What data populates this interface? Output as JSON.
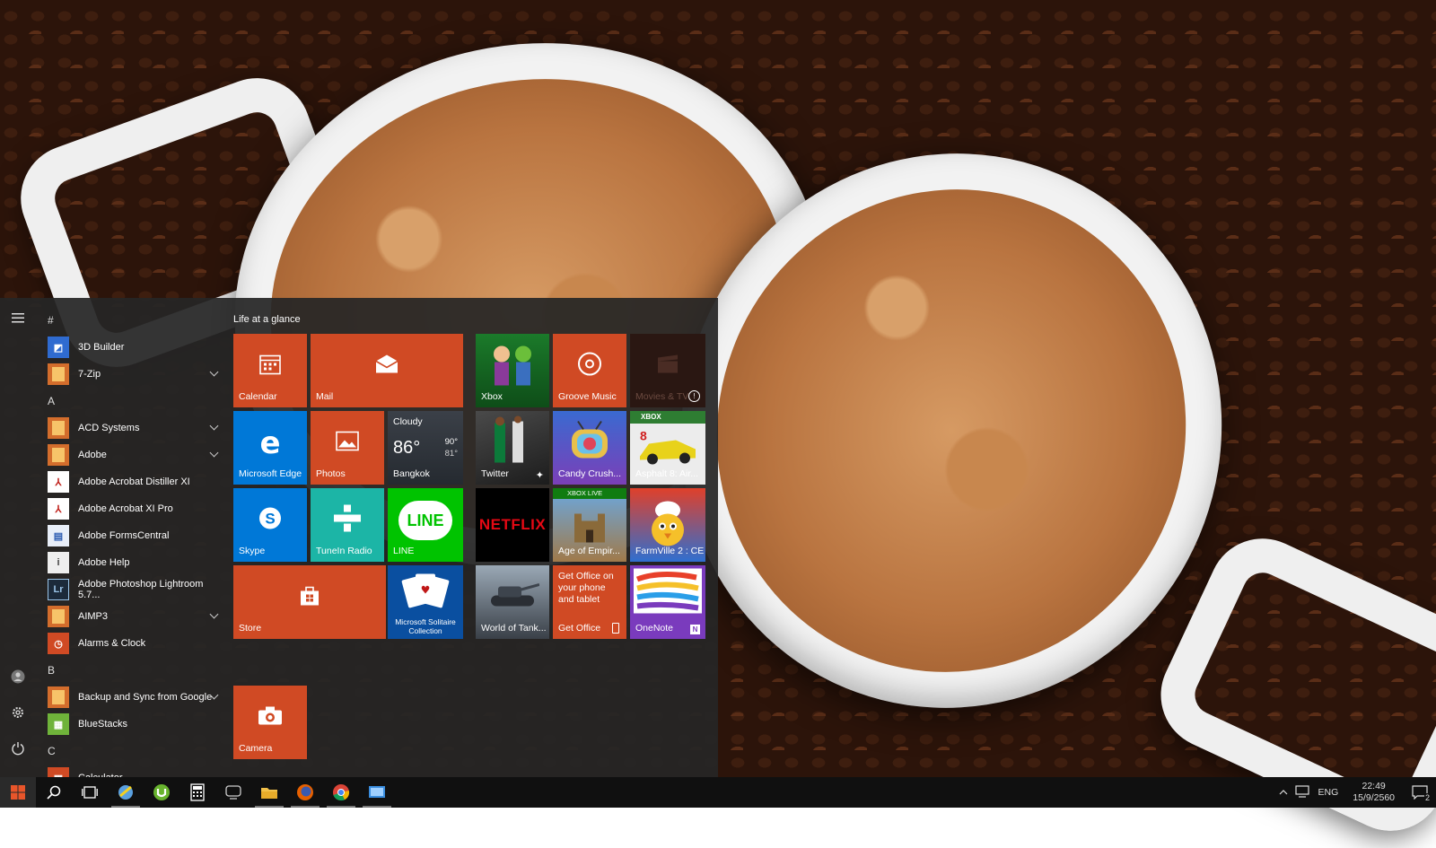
{
  "start_menu": {
    "group_title": "Life at a glance",
    "app_groups": [
      {
        "letter": "#",
        "items": [
          {
            "name": "3D Builder",
            "icon": "3d-builder-icon",
            "expandable": false
          },
          {
            "name": "7-Zip",
            "icon": "folder-icon",
            "expandable": true
          }
        ]
      },
      {
        "letter": "A",
        "items": [
          {
            "name": "ACD Systems",
            "icon": "folder-icon",
            "expandable": true
          },
          {
            "name": "Adobe",
            "icon": "folder-icon",
            "expandable": true
          },
          {
            "name": "Adobe Acrobat Distiller XI",
            "icon": "acrobat-icon",
            "expandable": false
          },
          {
            "name": "Adobe Acrobat XI Pro",
            "icon": "acrobat-icon",
            "expandable": false
          },
          {
            "name": "Adobe FormsCentral",
            "icon": "formscentral-icon",
            "expandable": false
          },
          {
            "name": "Adobe Help",
            "icon": "adobe-help-icon",
            "expandable": false
          },
          {
            "name": "Adobe Photoshop Lightroom 5.7...",
            "icon": "lightroom-icon",
            "expandable": false
          },
          {
            "name": "AIMP3",
            "icon": "folder-icon",
            "expandable": true
          },
          {
            "name": "Alarms & Clock",
            "icon": "alarm-clock-icon",
            "expandable": false
          }
        ]
      },
      {
        "letter": "B",
        "items": [
          {
            "name": "Backup and Sync from Google",
            "icon": "folder-icon",
            "expandable": true
          },
          {
            "name": "BlueStacks",
            "icon": "bluestacks-icon",
            "expandable": false
          }
        ]
      },
      {
        "letter": "C",
        "items": [
          {
            "name": "Calculator",
            "icon": "calculator-icon",
            "expandable": false
          }
        ]
      }
    ],
    "tiles": {
      "calendar": "Calendar",
      "mail": "Mail",
      "xbox": "Xbox",
      "groove": "Groove Music",
      "movies": "Movies & TV",
      "edge": "Microsoft Edge",
      "photos": "Photos",
      "weather": {
        "condition": "Cloudy",
        "temp": "86°",
        "high": "90°",
        "low": "81°",
        "city": "Bangkok"
      },
      "twitter": "Twitter",
      "candy": "Candy Crush...",
      "asphalt": "Asphalt 8: Air...",
      "asphalt_badge": "XBOX",
      "skype": "Skype",
      "tunein": "TuneIn Radio",
      "line": "LINE",
      "line_logo": "LINE",
      "netflix": "NETFLIX",
      "age": "Age of Empir...",
      "age_badge": "XBOX LIVE",
      "farmville": "FarmVille 2 : CE",
      "store": "Store",
      "solitaire": "Microsoft Solitaire Collection",
      "wot": "World of Tank...",
      "get_office_text": "Get Office on your phone and tablet",
      "get_office": "Get Office",
      "onenote": "OneNote",
      "camera": "Camera"
    }
  },
  "taskbar": {
    "language": "ENG",
    "time": "22:49",
    "date": "15/9/2560",
    "notification_count": "2"
  },
  "colors": {
    "accent": "#d04a24",
    "edge_blue": "#0078d7",
    "line_green": "#00c300",
    "onenote_purple": "#7a3bbd"
  }
}
